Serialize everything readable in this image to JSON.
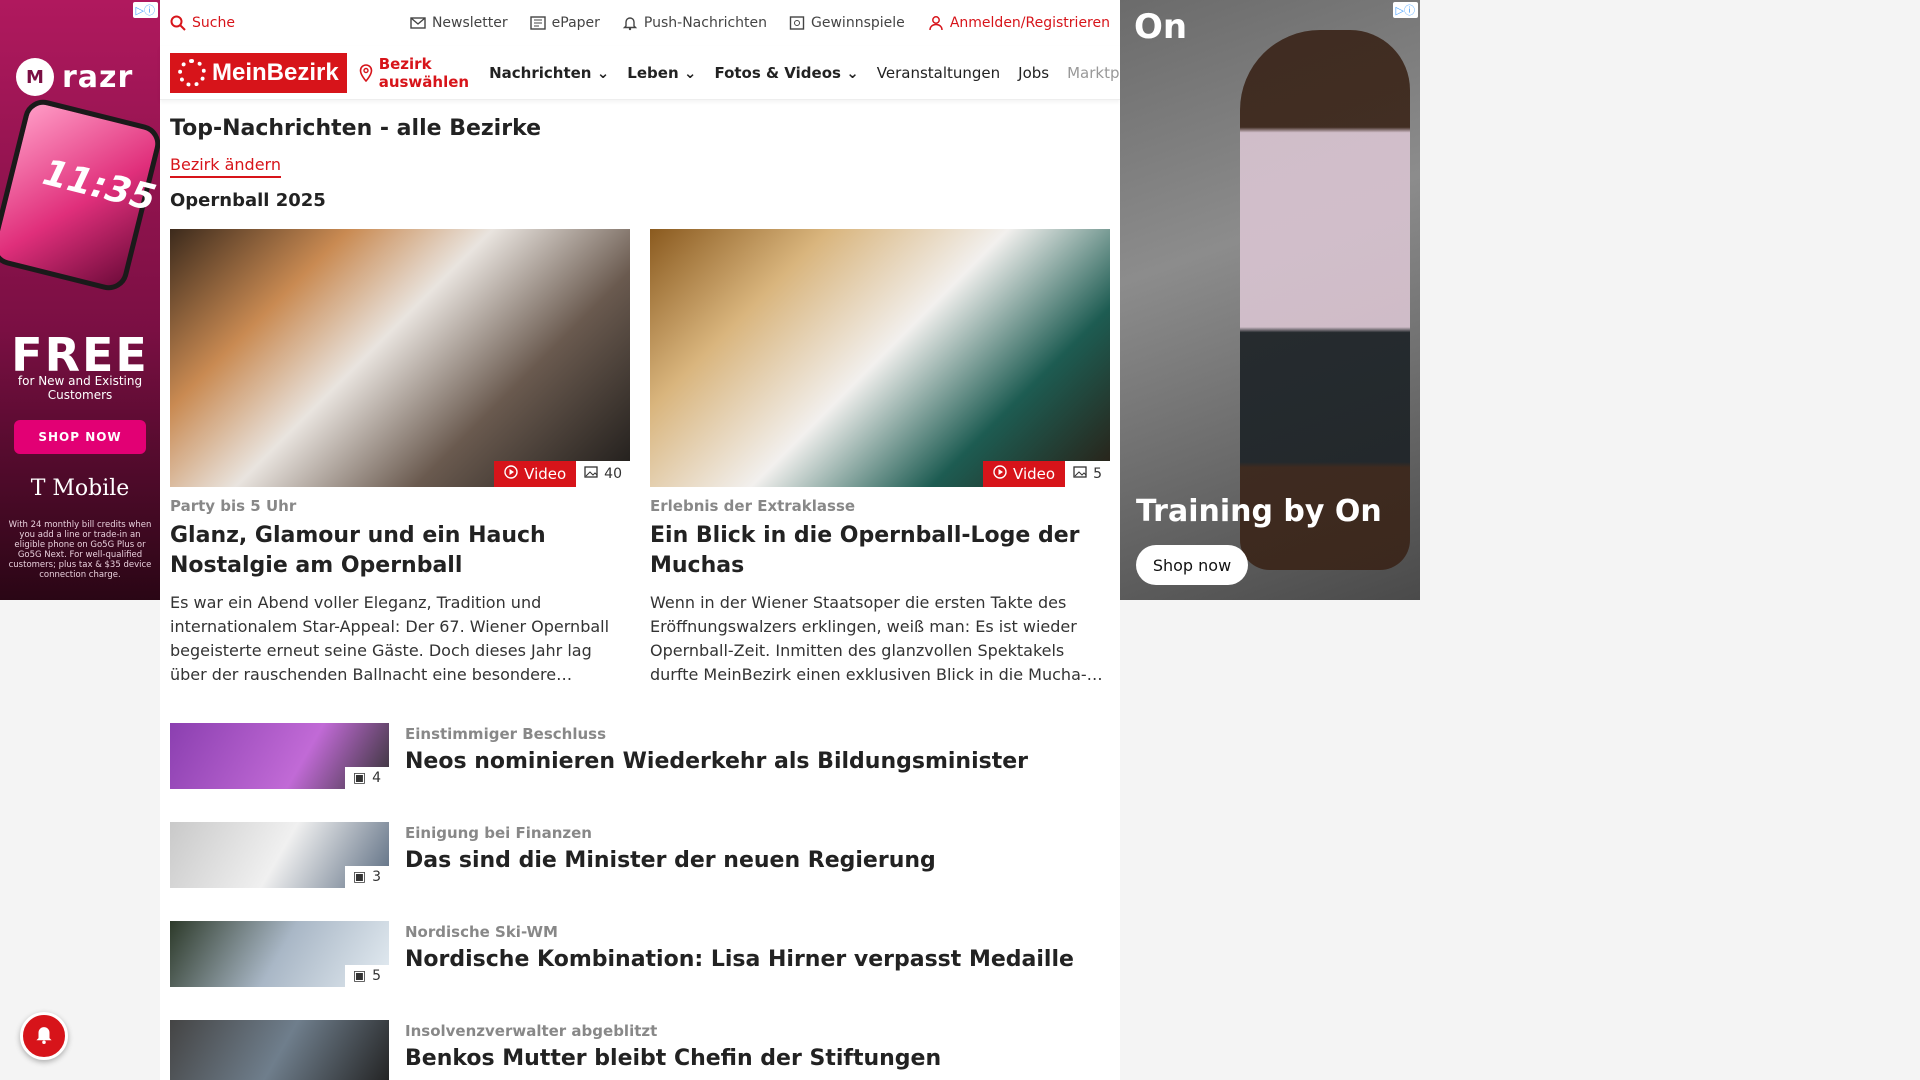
{
  "ads": {
    "left": {
      "brand": "razr",
      "phone_time": "11:35",
      "headline": "FREE",
      "subline": "for New and Existing Customers",
      "cta": "SHOP NOW",
      "advertiser": "T Mobile",
      "fineprint": "With 24 monthly bill credits when you add a line or trade-in an eligible phone on Go5G Plus or Go5G Next. For well-qualified customers; plus tax & $35 device connection charge."
    },
    "right": {
      "brand_mark": "On",
      "headline": "Training by On",
      "cta": "Shop now"
    }
  },
  "topbar": {
    "search": "Suche",
    "newsletter": "Newsletter",
    "epaper": "ePaper",
    "push": "Push-Nachrichten",
    "gewinnspiele": "Gewinnspiele",
    "login": "Anmelden/Registrieren"
  },
  "nav": {
    "logo": "MeinBezirk",
    "bezirk": "Bezirk auswählen",
    "links": [
      "Nachrichten",
      "Leben",
      "Fotos & Videos",
      "Veranstaltungen",
      "Jobs",
      "Marktplatz"
    ]
  },
  "page": {
    "title": "Top-Nachrichten - alle Bezirke",
    "change_district": "Bezirk ändern",
    "topic": "Opernball 2025"
  },
  "featured": [
    {
      "video_label": "Video",
      "image_count": "40",
      "kicker": "Party bis 5 Uhr",
      "title": "Glanz, Glamour und ein Hauch Nostalgie am Opernball",
      "teaser": "Es war ein Abend voller Eleganz, Tradition und internationalem Star-Appeal: Der 67. Wiener Opernball begeisterte erneut seine Gäste. Doch dieses Jahr lag über der rauschenden Ballnacht eine besondere…"
    },
    {
      "video_label": "Video",
      "image_count": "5",
      "kicker": "Erlebnis der Extraklasse",
      "title": "Ein Blick in die Opernball-Loge der Muchas",
      "teaser": "Wenn in der Wiener Staatsoper die ersten Takte des Eröffnungswalzers erklingen, weiß man: Es ist wieder Opernball-Zeit. Inmitten des glanzvollen Spektakels durfte MeinBezirk einen exklusiven Blick in die Mucha-…"
    }
  ],
  "list": [
    {
      "image_count": "4",
      "kicker": "Einstimmiger Beschluss",
      "title": "Neos nominieren Wiederkehr als Bildungsminister"
    },
    {
      "image_count": "3",
      "kicker": "Einigung bei Finanzen",
      "title": "Das sind die Minister der neuen Regierung"
    },
    {
      "image_count": "5",
      "kicker": "Nordische Ski-WM",
      "title": "Nordische Kombination: Lisa Hirner verpasst Medaille"
    },
    {
      "image_count": "",
      "kicker": "Insolvenzverwalter abgeblitzt",
      "title": "Benkos Mutter bleibt Chefin der Stiftungen"
    }
  ],
  "colors": {
    "accent": "#d7141a"
  }
}
